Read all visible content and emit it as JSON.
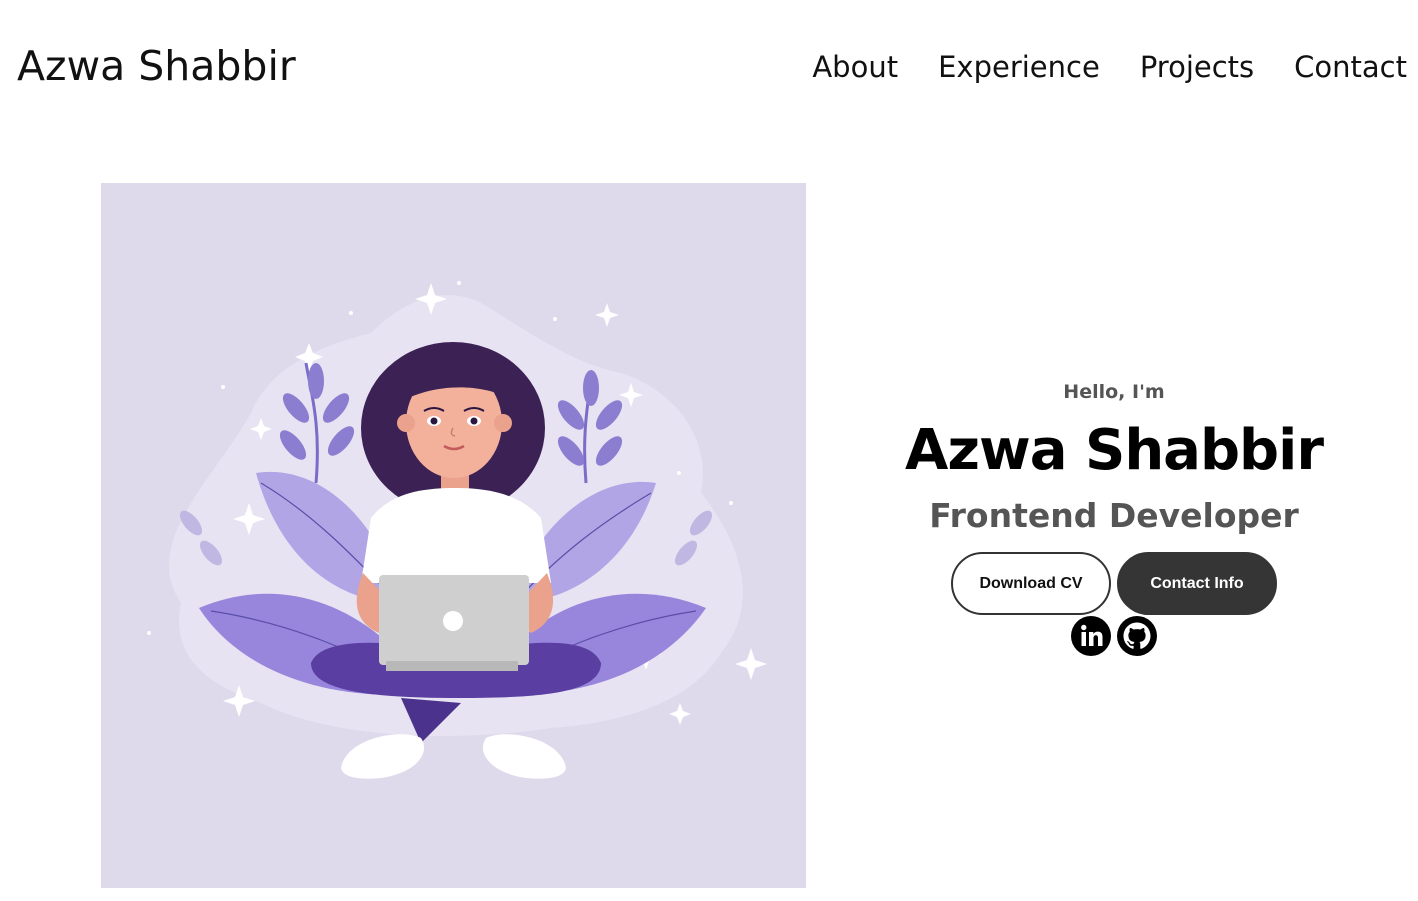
{
  "header": {
    "logo": "Azwa Shabbir",
    "nav": [
      {
        "label": "About"
      },
      {
        "label": "Experience"
      },
      {
        "label": "Projects"
      },
      {
        "label": "Contact"
      }
    ]
  },
  "hero": {
    "greeting": "Hello, I'm",
    "name": "Azwa Shabbir",
    "role": "Frontend Developer",
    "buttons": {
      "download_cv": "Download CV",
      "contact_info": "Contact Info"
    },
    "socials": [
      {
        "icon": "linkedin-icon"
      },
      {
        "icon": "github-icon"
      }
    ]
  },
  "colors": {
    "illustration_bg": "#dedaec",
    "solid_button": "#353535",
    "muted_text": "#555555"
  }
}
